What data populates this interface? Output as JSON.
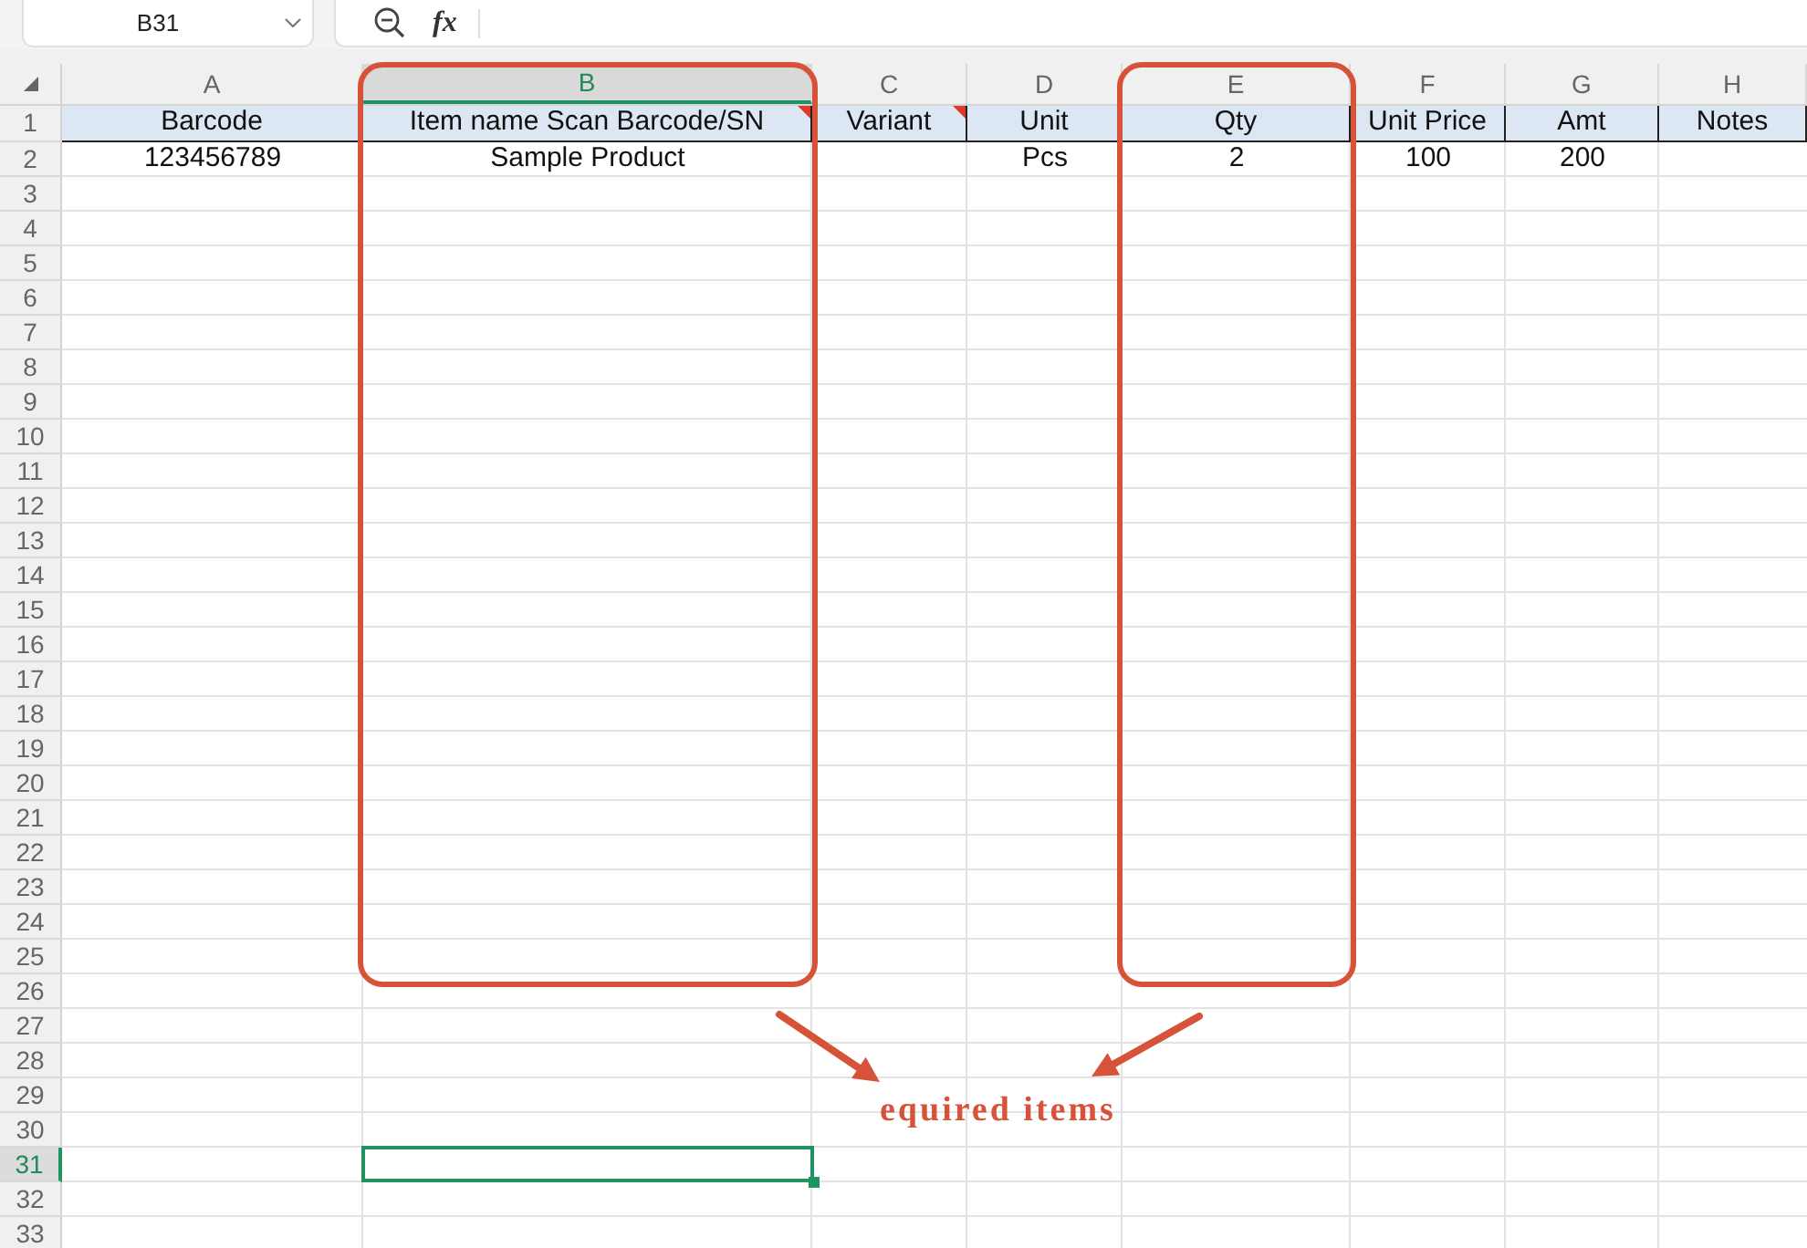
{
  "name_box": {
    "value": "B31"
  },
  "formula_bar": {
    "function_label": "fx"
  },
  "sheet": {
    "columns": [
      {
        "letter": "A",
        "selected": false,
        "highlighted": false
      },
      {
        "letter": "B",
        "selected": true,
        "highlighted": true
      },
      {
        "letter": "C",
        "selected": false,
        "highlighted": false
      },
      {
        "letter": "D",
        "selected": false,
        "highlighted": false
      },
      {
        "letter": "E",
        "selected": false,
        "highlighted": true
      },
      {
        "letter": "F",
        "selected": false,
        "highlighted": false
      },
      {
        "letter": "G",
        "selected": false,
        "highlighted": false
      },
      {
        "letter": "H",
        "selected": false,
        "highlighted": false
      }
    ],
    "rows": [
      {
        "number": "1",
        "selected": false,
        "kind": "header",
        "cells": [
          {
            "text": "Barcode",
            "comment": false
          },
          {
            "text": "Item name Scan Barcode/SN",
            "comment": true
          },
          {
            "text": "Variant",
            "comment": true
          },
          {
            "text": "Unit",
            "comment": false
          },
          {
            "text": "Qty",
            "comment": false
          },
          {
            "text": "Unit Price",
            "comment": false
          },
          {
            "text": "Amt",
            "comment": false
          },
          {
            "text": "Notes",
            "comment": false
          }
        ]
      },
      {
        "number": "2",
        "selected": false,
        "kind": "data",
        "cells": [
          {
            "text": "123456789",
            "comment": false
          },
          {
            "text": "Sample Product",
            "comment": false
          },
          null,
          {
            "text": "Pcs",
            "comment": false
          },
          {
            "text": "2",
            "comment": false
          },
          {
            "text": "100",
            "comment": false
          },
          {
            "text": "200",
            "comment": false
          },
          null
        ]
      },
      {
        "number": "3",
        "selected": false,
        "kind": "data"
      },
      {
        "number": "4",
        "selected": false,
        "kind": "data"
      },
      {
        "number": "5",
        "selected": false,
        "kind": "data"
      },
      {
        "number": "6",
        "selected": false,
        "kind": "data"
      },
      {
        "number": "7",
        "selected": false,
        "kind": "data"
      },
      {
        "number": "8",
        "selected": false,
        "kind": "data"
      },
      {
        "number": "9",
        "selected": false,
        "kind": "data"
      },
      {
        "number": "10",
        "selected": false,
        "kind": "data"
      },
      {
        "number": "11",
        "selected": false,
        "kind": "data"
      },
      {
        "number": "12",
        "selected": false,
        "kind": "data"
      },
      {
        "number": "13",
        "selected": false,
        "kind": "data"
      },
      {
        "number": "14",
        "selected": false,
        "kind": "data"
      },
      {
        "number": "15",
        "selected": false,
        "kind": "data"
      },
      {
        "number": "16",
        "selected": false,
        "kind": "data"
      },
      {
        "number": "17",
        "selected": false,
        "kind": "data"
      },
      {
        "number": "18",
        "selected": false,
        "kind": "data"
      },
      {
        "number": "19",
        "selected": false,
        "kind": "data"
      },
      {
        "number": "20",
        "selected": false,
        "kind": "data"
      },
      {
        "number": "21",
        "selected": false,
        "kind": "data"
      },
      {
        "number": "22",
        "selected": false,
        "kind": "data"
      },
      {
        "number": "23",
        "selected": false,
        "kind": "data"
      },
      {
        "number": "24",
        "selected": false,
        "kind": "data"
      },
      {
        "number": "25",
        "selected": false,
        "kind": "data"
      },
      {
        "number": "26",
        "selected": false,
        "kind": "data"
      },
      {
        "number": "27",
        "selected": false,
        "kind": "data"
      },
      {
        "number": "28",
        "selected": false,
        "kind": "data"
      },
      {
        "number": "29",
        "selected": false,
        "kind": "data"
      },
      {
        "number": "30",
        "selected": false,
        "kind": "data"
      },
      {
        "number": "31",
        "selected": true,
        "kind": "data"
      },
      {
        "number": "32",
        "selected": false,
        "kind": "data"
      },
      {
        "number": "33",
        "selected": false,
        "kind": "data"
      }
    ]
  },
  "annotation": {
    "text": "equired items"
  }
}
